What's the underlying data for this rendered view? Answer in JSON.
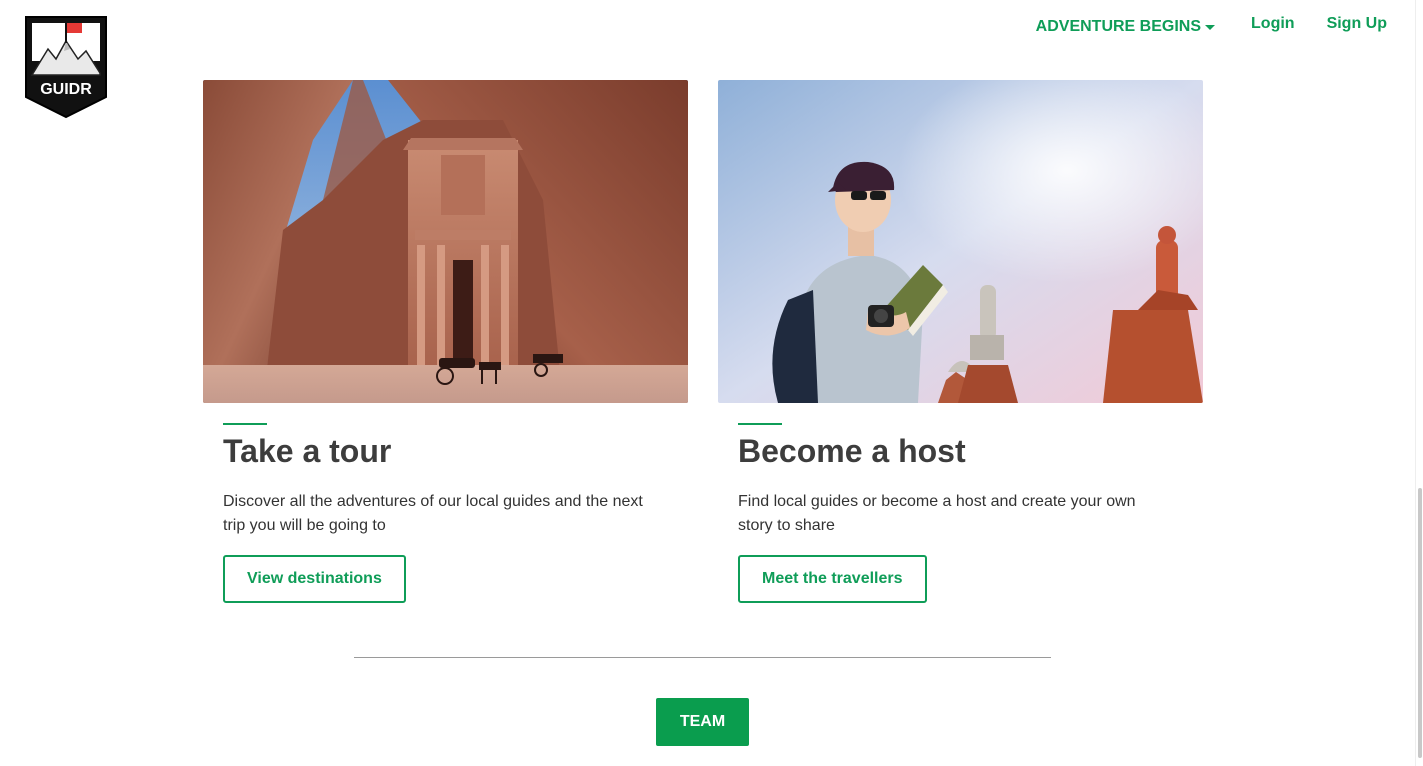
{
  "brand": {
    "logo_text": "GUIDR",
    "accent": "#0f9d58"
  },
  "nav": {
    "dropdown_label": "ADVENTURE BEGINS",
    "login_label": "Login",
    "signup_label": "Sign Up"
  },
  "cards": [
    {
      "image": "petra-treasury-photo",
      "title": "Take a tour",
      "text": "Discover all the adventures of our local guides and the next trip you will be going to",
      "button": "View destinations"
    },
    {
      "image": "traveller-reading-photo",
      "title": "Become a host",
      "text": "Find local guides or become a host and create your own story to share",
      "button": "Meet the travellers"
    }
  ],
  "footer": {
    "team_button": "TEAM"
  },
  "colors": {
    "primary_green": "#0f9d58",
    "team_button_bg": "#0a9d4e",
    "title_text": "#3d3d3d"
  }
}
